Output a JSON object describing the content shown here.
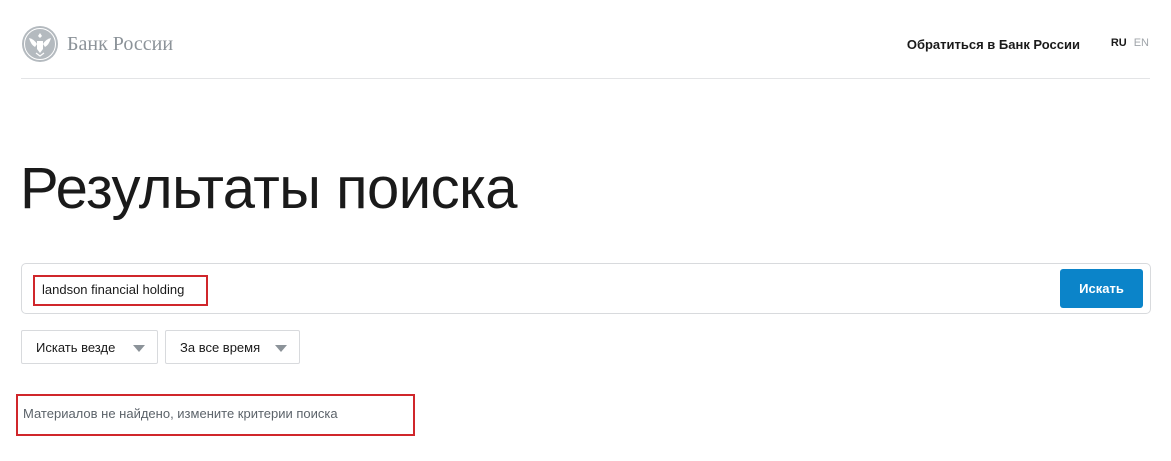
{
  "header": {
    "bank_name": "Банк России",
    "contact_link": "Обратиться в Банк России",
    "lang_ru": "RU",
    "lang_en": "EN",
    "logo_icon": "double-headed-eagle-emblem"
  },
  "main": {
    "title": "Результаты поиска"
  },
  "search": {
    "query": "landson financial holding",
    "button_label": "Искать"
  },
  "filters": {
    "where": "Искать везде",
    "time": "За все время"
  },
  "results": {
    "message": "Материалов не найдено, измените критерии поиска"
  },
  "colors": {
    "accent": "#0b84c9",
    "highlight": "#d0262b",
    "muted": "#8c9399"
  }
}
